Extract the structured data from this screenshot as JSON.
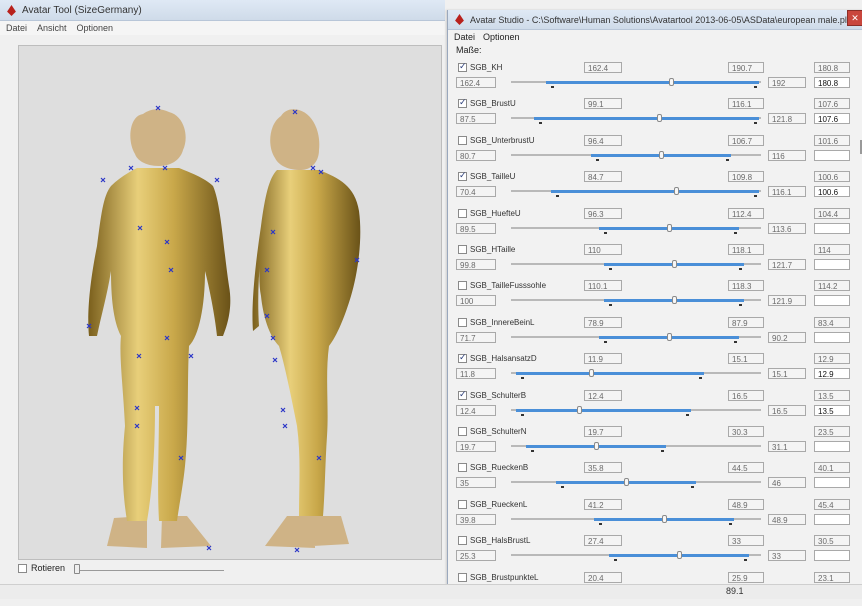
{
  "left_window": {
    "title": "Avatar Tool (SizeGermany)",
    "menu": [
      "Datei",
      "Ansicht",
      "Optionen"
    ],
    "rotate_label": "Rotieren"
  },
  "right_window": {
    "title": "Avatar Studio - C:\\Software\\Human Solutions\\Avatartool 2013-06-05\\ASData\\european male.ply",
    "close_label": "✕",
    "menu": [
      "Datei",
      "Optionen"
    ],
    "masse_label": "Maße:",
    "rows": [
      {
        "name": "SGB_KH",
        "checked": true,
        "lo_top": "162.4",
        "hi_top": "190.7",
        "min": "162.4",
        "max": "192",
        "right_top": "180.8",
        "right_val": "180.8",
        "thumb": 0.64
      },
      {
        "name": "SGB_BrustU",
        "checked": true,
        "lo_top": "99.1",
        "hi_top": "116.1",
        "min": "87.5",
        "max": "121.8",
        "right_top": "107.6",
        "right_val": "107.6",
        "thumb": 0.59
      },
      {
        "name": "SGB_UnterbrustU",
        "checked": false,
        "lo_top": "96.4",
        "hi_top": "106.7",
        "min": "80.7",
        "max": "116",
        "right_top": "101.6",
        "right_val": "",
        "thumb": 0.6
      },
      {
        "name": "SGB_TailleU",
        "checked": true,
        "lo_top": "84.7",
        "hi_top": "109.8",
        "min": "70.4",
        "max": "116.1",
        "right_top": "100.6",
        "right_val": "100.6",
        "thumb": 0.66
      },
      {
        "name": "SGB_HuefteU",
        "checked": false,
        "lo_top": "96.3",
        "hi_top": "112.4",
        "min": "89.5",
        "max": "113.6",
        "right_top": "104.4",
        "right_val": "",
        "thumb": 0.63
      },
      {
        "name": "SGB_HTaille",
        "checked": false,
        "lo_top": "110",
        "hi_top": "118.1",
        "min": "99.8",
        "max": "121.7",
        "right_top": "114",
        "right_val": "",
        "thumb": 0.65
      },
      {
        "name": "SGB_TailleFusssohle",
        "checked": false,
        "lo_top": "110.1",
        "hi_top": "118.3",
        "min": "100",
        "max": "121.9",
        "right_top": "114.2",
        "right_val": "",
        "thumb": 0.65
      },
      {
        "name": "SGB_InnereBeinL",
        "checked": false,
        "lo_top": "78.9",
        "hi_top": "87.9",
        "min": "71.7",
        "max": "90.2",
        "right_top": "83.4",
        "right_val": "",
        "thumb": 0.63
      },
      {
        "name": "SGB_HalsansatzD",
        "checked": true,
        "lo_top": "11.9",
        "hi_top": "15.1",
        "min": "11.8",
        "max": "15.1",
        "right_top": "12.9",
        "right_val": "12.9",
        "thumb": 0.32
      },
      {
        "name": "SGB_SchulterB",
        "checked": true,
        "lo_top": "12.4",
        "hi_top": "16.5",
        "min": "12.4",
        "max": "16.5",
        "right_top": "13.5",
        "right_val": "13.5",
        "thumb": 0.27
      },
      {
        "name": "SGB_SchulterN",
        "checked": false,
        "lo_top": "19.7",
        "hi_top": "30.3",
        "min": "19.7",
        "max": "31.1",
        "right_top": "23.5",
        "right_val": "",
        "thumb": 0.34
      },
      {
        "name": "SGB_RueckenB",
        "checked": false,
        "lo_top": "35.8",
        "hi_top": "44.5",
        "min": "35",
        "max": "46",
        "right_top": "40.1",
        "right_val": "",
        "thumb": 0.46
      },
      {
        "name": "SGB_RueckenL",
        "checked": false,
        "lo_top": "41.2",
        "hi_top": "48.9",
        "min": "39.8",
        "max": "48.9",
        "right_top": "45.4",
        "right_val": "",
        "thumb": 0.61
      },
      {
        "name": "SGB_HalsBrustL",
        "checked": false,
        "lo_top": "27.4",
        "hi_top": "33",
        "min": "25.3",
        "max": "33",
        "right_top": "30.5",
        "right_val": "",
        "thumb": 0.67
      },
      {
        "name": "SGB_BrustpunkteL",
        "checked": false,
        "lo_top": "20.4",
        "hi_top": "25.9",
        "min": "",
        "max": "",
        "right_top": "23.1",
        "right_val": "",
        "thumb": 0.5
      }
    ]
  },
  "status_value": "89.1",
  "colors": {
    "accent": "#4a8fd8",
    "body_gold": "#c9a84a",
    "head_tan": "#cfb386",
    "marker": "#2b36c8"
  }
}
